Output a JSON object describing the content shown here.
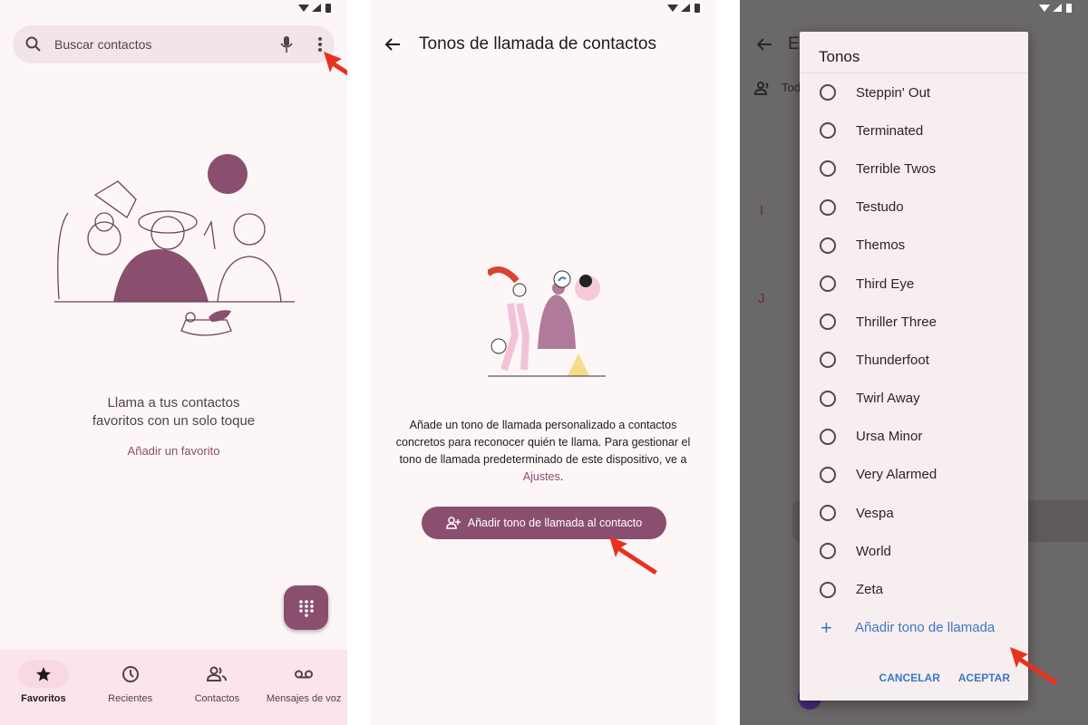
{
  "screen1": {
    "search_placeholder": "Buscar contactos",
    "empty_title_line1": "Llama a tus contactos",
    "empty_title_line2": "favoritos con un solo toque",
    "add_favorite": "Añadir un favorito",
    "nav": [
      {
        "label": "Favoritos",
        "icon": "star-icon",
        "active": true
      },
      {
        "label": "Recientes",
        "icon": "clock-icon",
        "active": false
      },
      {
        "label": "Contactos",
        "icon": "people-icon",
        "active": false
      },
      {
        "label": "Mensajes de voz",
        "icon": "voicemail-icon",
        "active": false
      }
    ]
  },
  "screen2": {
    "title": "Tonos de llamada de contactos",
    "description": "Añade un tono de llamada personalizado a contactos concretos para reconocer quién te llama. Para gestionar el tono de llamada predeterminado de este dispositivo, ve a",
    "settings_link": "Ajustes",
    "period": ".",
    "cta": "Añadir tono de llamada al contacto"
  },
  "screen3": {
    "bg_title": "El",
    "bg_filter": "Tod",
    "bg_letters": [
      "I",
      "J"
    ],
    "dialog": {
      "title": "Tonos",
      "options": [
        "Steppin' Out",
        "Terminated",
        "Terrible Twos",
        "Testudo",
        "Themos",
        "Third Eye",
        "Thriller Three",
        "Thunderfoot",
        "Twirl Away",
        "Ursa Minor",
        "Very Alarmed",
        "Vespa",
        "World",
        "Zeta"
      ],
      "add_ringtone": "Añadir tono de llamada",
      "cancel": "CANCELAR",
      "accept": "ACEPTAR"
    }
  },
  "colors": {
    "accent": "#8a4f6e",
    "dialog_link": "#3b78c8",
    "annotation_arrow": "#e8321e"
  }
}
